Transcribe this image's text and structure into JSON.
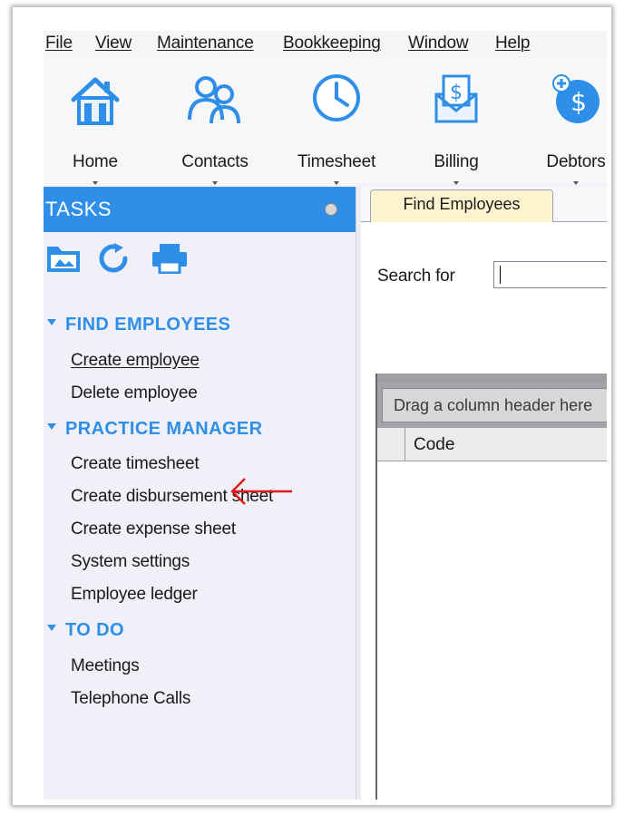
{
  "menu": {
    "file": "File",
    "view": "View",
    "maintenance": "Maintenance",
    "bookkeeping": "Bookkeeping",
    "window": "Window",
    "help": "Help"
  },
  "toolbar": {
    "home": "Home",
    "contacts": "Contacts",
    "timesheet": "Timesheet",
    "billing": "Billing",
    "debtors": "Debtors"
  },
  "tasks": {
    "title": "TASKS",
    "sections": [
      {
        "title": "FIND EMPLOYEES",
        "items": [
          "Create employee",
          "Delete employee"
        ]
      },
      {
        "title": "PRACTICE MANAGER",
        "items": [
          "Create timesheet",
          "Create disbursement sheet",
          "Create expense sheet",
          "System settings",
          "Employee ledger"
        ]
      },
      {
        "title": "TO DO",
        "items": [
          "Meetings",
          "Telephone Calls"
        ]
      }
    ]
  },
  "main": {
    "tab": "Find Employees",
    "search_label": "Search for",
    "search_value": "",
    "group_hint": "Drag a column header here",
    "columns": [
      "Code"
    ]
  },
  "colors": {
    "accent": "#2f8fe8",
    "tab": "#fdf3cf",
    "annotation_arrow": "#e01b1b"
  }
}
